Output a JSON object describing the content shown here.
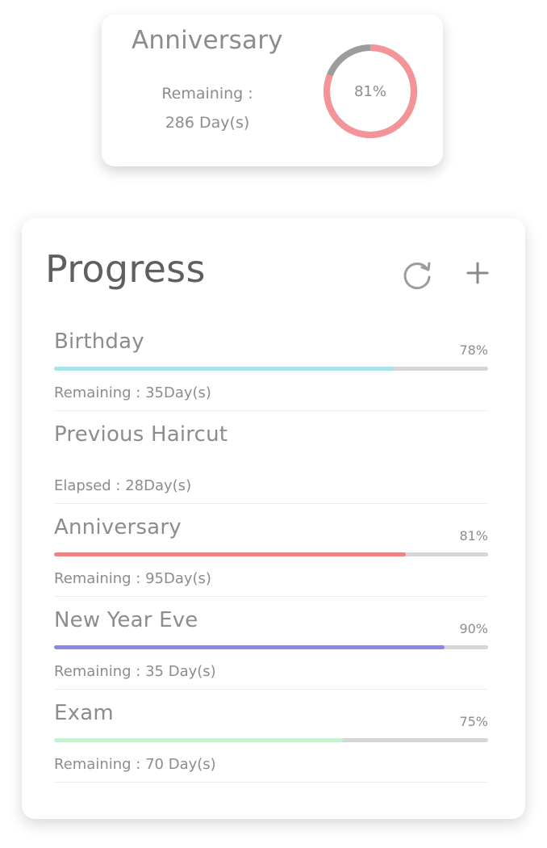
{
  "top_card": {
    "title": "Anniversary",
    "remaining_label": "Remaining :",
    "remaining_value": "286 Day(s)",
    "percent_text": "81%",
    "percent": 81,
    "ring_color": "#f49499",
    "ring_track_color": "#9c9c9c"
  },
  "progress": {
    "title": "Progress",
    "refresh_icon": "refresh-icon",
    "add_icon": "plus-icon",
    "items": [
      {
        "title": "Birthday",
        "percent_text": "78%",
        "percent": 78,
        "color": "#a6e6ea",
        "sub": "Remaining : 35Day(s)"
      },
      {
        "title": "Previous Haircut",
        "percent_text": "",
        "percent": null,
        "color": "",
        "sub": "Elapsed : 28Day(s)"
      },
      {
        "title": "Anniversary",
        "percent_text": "81%",
        "percent": 81,
        "color": "#ee8383",
        "sub": "Remaining : 95Day(s)"
      },
      {
        "title": "New Year Eve",
        "percent_text": "90%",
        "percent": 90,
        "color": "#8b86ec",
        "sub": "Remaining : 35 Day(s)"
      },
      {
        "title": "Exam",
        "percent_text": "75%",
        "percent": 66.5,
        "color": "#c6f2d1",
        "sub": "Remaining : 70 Day(s)"
      }
    ]
  }
}
